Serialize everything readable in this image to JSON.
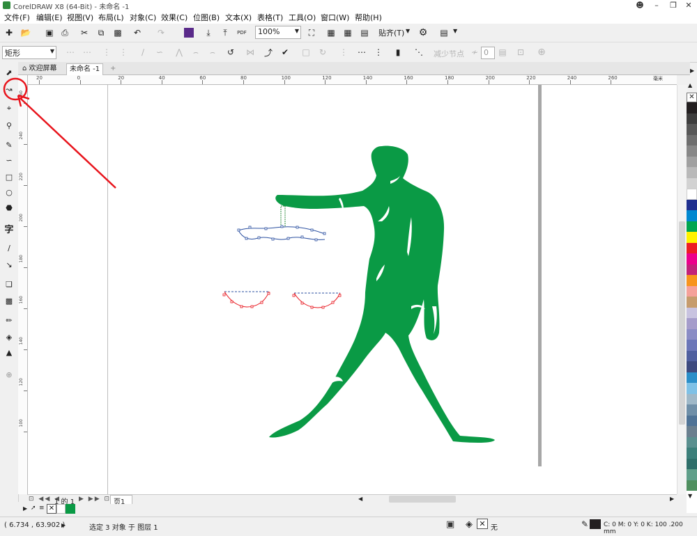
{
  "titlebar": {
    "title": "CorelDRAW X8 (64-Bit) - 未命名 -1"
  },
  "menubar": {
    "items": [
      "文件(F)",
      "编辑(E)",
      "视图(V)",
      "布局(L)",
      "对象(C)",
      "效果(C)",
      "位图(B)",
      "文本(X)",
      "表格(T)",
      "工具(O)",
      "窗口(W)",
      "帮助(H)"
    ]
  },
  "toolbar1": {
    "zoom_value": "100%",
    "snap_label": "贴齐(T)",
    "pdf_label": "PDF"
  },
  "toolbar2": {
    "shape_select": "矩形",
    "reduce_nodes_label": "减少节点",
    "curve_smooth_value": "0"
  },
  "tabs": [
    {
      "label": "欢迎屏幕"
    },
    {
      "label": "未命名 -1"
    }
  ],
  "ruler_h": {
    "ticks": [
      "20",
      "0",
      "20",
      "40",
      "60",
      "80",
      "100",
      "120",
      "140",
      "160",
      "180",
      "200",
      "220",
      "240",
      "260"
    ],
    "unit": "毫米"
  },
  "ruler_v": {
    "ticks": [
      "260",
      "240",
      "220",
      "200",
      "180",
      "160",
      "140",
      "120",
      "100"
    ]
  },
  "page_nav": {
    "page_count_label": "1 的 1",
    "page_tab": "页1"
  },
  "status": {
    "coordinates": "( 6.734 , 63.902 )",
    "selection_info": "选定 3 对象 于 图层 1",
    "fill_none": "无",
    "outline_info": "C: 0 M: 0 Y: 0 K: 100 .200 mm"
  },
  "colors": {
    "figure": "#0a9a45",
    "annotation": "#e8141c",
    "palette": [
      "#231f20",
      "#3d3d3d",
      "#575757",
      "#6e6e6e",
      "#878787",
      "#a0a0a0",
      "#b9b9b9",
      "#d2d2d2",
      "#ffffff",
      "#1f2f8f",
      "#0088d0",
      "#00a54f",
      "#fff200",
      "#ec1c24",
      "#ec008c",
      "#c2227a",
      "#f7941d",
      "#f5a19a",
      "#c69c6d",
      "#c8c3e0",
      "#a59ccb",
      "#8a8cc5",
      "#6b76b8",
      "#4f5f9f",
      "#3d4a7f",
      "#2b8fc9",
      "#7fc1e6",
      "#9fb8c8",
      "#6f8fa8",
      "#4f7396",
      "#6a7f8f",
      "#5a8f8f",
      "#3c7f7a",
      "#2f6f6a",
      "#5f9f8a",
      "#4f8f5f"
    ]
  }
}
